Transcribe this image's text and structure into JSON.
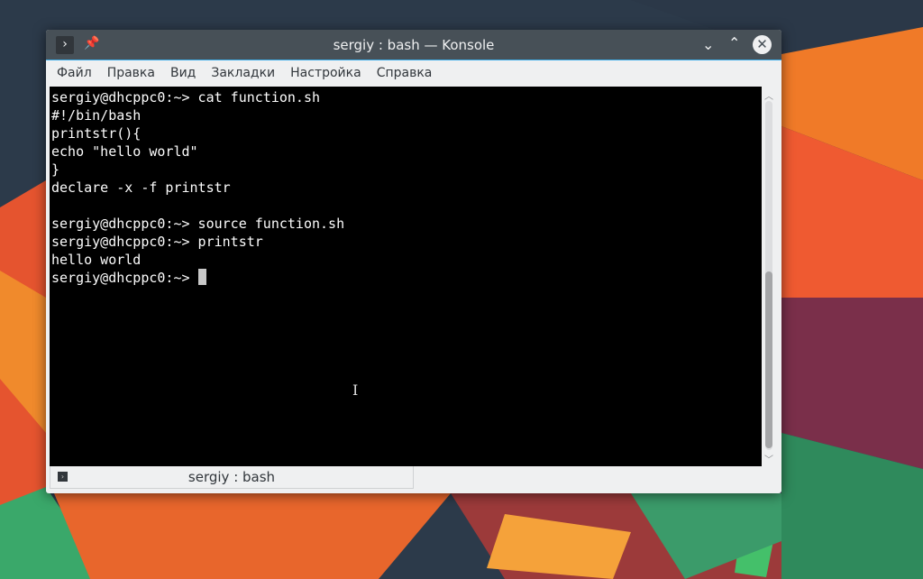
{
  "window": {
    "title": "sergiy : bash — Konsole"
  },
  "menu": [
    "Файл",
    "Правка",
    "Вид",
    "Закладки",
    "Настройка",
    "Справка"
  ],
  "terminal": {
    "lines": [
      "sergiy@dhcppc0:~> cat function.sh",
      "#!/bin/bash",
      "printstr(){",
      "echo \"hello world\"",
      "}",
      "declare -x -f printstr",
      "",
      "sergiy@dhcppc0:~> source function.sh",
      "sergiy@dhcppc0:~> printstr",
      "hello world",
      "sergiy@dhcppc0:~> "
    ]
  },
  "tab": {
    "label": "sergiy : bash"
  },
  "scrollbar": {
    "position_fraction": 0.98
  }
}
